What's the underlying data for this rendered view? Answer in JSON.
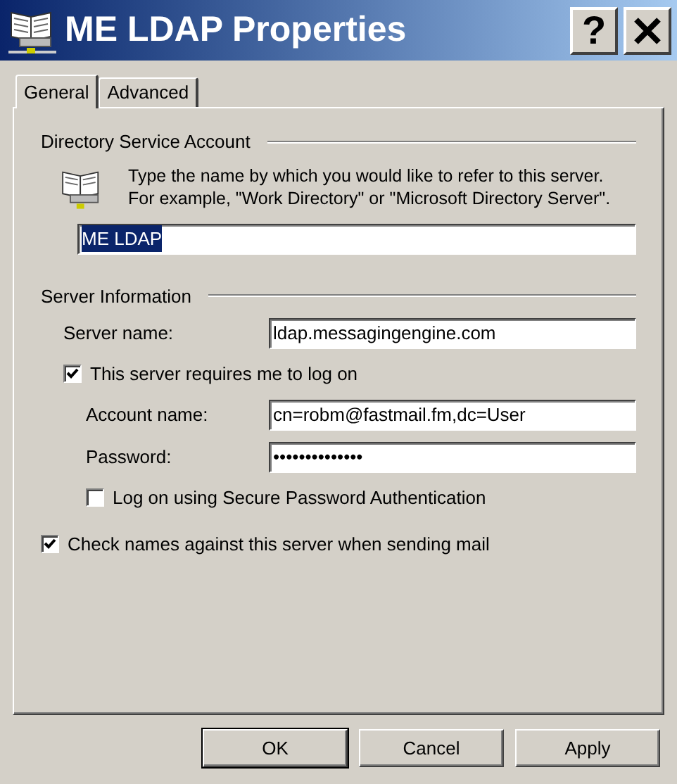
{
  "window": {
    "title": "ME LDAP Properties",
    "buttons": [
      {
        "label": "?",
        "kind": "help"
      },
      {
        "kind": "close"
      }
    ]
  },
  "tabs": [
    {
      "label": "General",
      "selected": true
    },
    {
      "label": "Advanced",
      "selected": false
    }
  ],
  "directory_account": {
    "heading": "Directory Service Account",
    "description": "Type the name by which you would like to refer to this server. For example, \"Work Directory\" or \"Microsoft Directory Server\".",
    "name_field": {
      "value": "ME LDAP",
      "highlighted": true
    }
  },
  "server_info": {
    "heading": "Server Information",
    "server_name": {
      "label": "Server name:",
      "value": "ldap.messagingengine.com"
    },
    "requires_logon": {
      "label": "This server requires me to log on",
      "checked": true
    },
    "account_name": {
      "label": "Account name:",
      "value": "cn=robm@fastmail.fm,dc=User"
    },
    "password": {
      "label": "Password:",
      "value": "••••••••••••••"
    },
    "spa": {
      "label": "Log on using Secure Password Authentication",
      "checked": false
    }
  },
  "check_names": {
    "label": "Check names against this server when sending mail",
    "checked": true
  },
  "buttons": [
    {
      "label": "OK",
      "default": true
    },
    {
      "label": "Cancel",
      "default": false
    },
    {
      "label": "Apply",
      "default": false
    }
  ]
}
